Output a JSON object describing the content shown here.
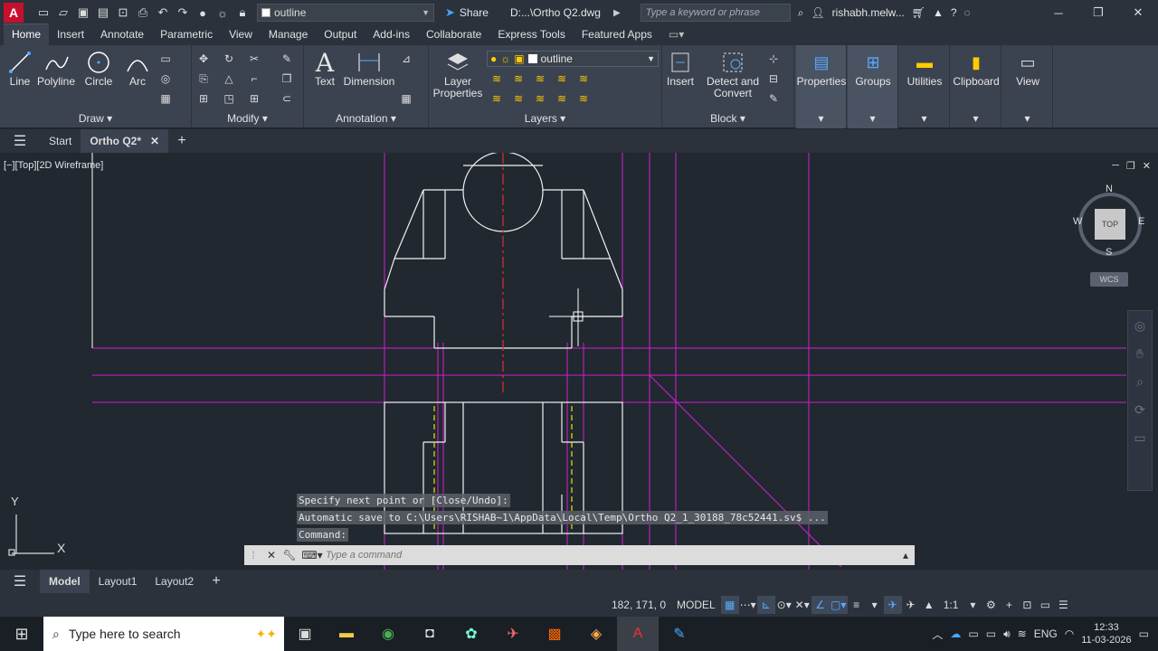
{
  "titlebar": {
    "logo": "A",
    "layer_name": "outline",
    "share_label": "Share",
    "doc_title": "D:...\\Ortho Q2.dwg",
    "search_placeholder": "Type a keyword or phrase",
    "user_name": "rishabh.melw..."
  },
  "ribbon_tabs": [
    "Home",
    "Insert",
    "Annotate",
    "Parametric",
    "View",
    "Manage",
    "Output",
    "Add-ins",
    "Collaborate",
    "Express Tools",
    "Featured Apps"
  ],
  "ribbon": {
    "draw": {
      "title": "Draw",
      "tools": [
        "Line",
        "Polyline",
        "Circle",
        "Arc"
      ]
    },
    "modify": {
      "title": "Modify"
    },
    "annotation": {
      "title": "Annotation",
      "tools": [
        "Text",
        "Dimension"
      ]
    },
    "layers": {
      "title": "Layers",
      "layer_properties": "Layer\nProperties",
      "current_layer": "outline"
    },
    "block": {
      "title": "Block",
      "tools": [
        "Insert",
        "Detect and\nConvert"
      ]
    },
    "groups": [
      "Properties",
      "Groups",
      "Utilities",
      "Clipboard",
      "View"
    ]
  },
  "doc_tabs": {
    "start": "Start",
    "active": "Ortho Q2*"
  },
  "viewport": {
    "label": "[−][Top][2D Wireframe]",
    "viewcube": {
      "top": "TOP",
      "n": "N",
      "s": "S",
      "e": "E",
      "w": "W",
      "wcs": "WCS"
    },
    "ucs_y": "Y",
    "ucs_x": "X"
  },
  "command": {
    "history": [
      "Specify next point or [Close/Undo]:",
      "Automatic save to C:\\Users\\RISHAB~1\\AppData\\Local\\Temp\\Ortho Q2_1_30188_78c52441.sv$ ...",
      "Command:"
    ],
    "placeholder": "Type a command"
  },
  "layout_tabs": [
    "Model",
    "Layout1",
    "Layout2"
  ],
  "status": {
    "coords": "182, 171, 0",
    "model": "MODEL",
    "scale": "1:1"
  },
  "taskbar": {
    "search_placeholder": "Type here to search",
    "lang": "ENG",
    "time": "12:33",
    "date": "11-03-2026"
  }
}
